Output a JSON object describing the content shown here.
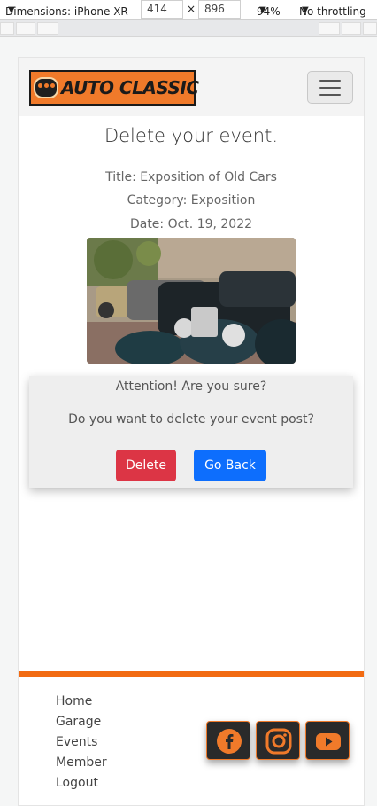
{
  "devtools": {
    "device": "Dimensions: iPhone XR",
    "width": "414",
    "times": "×",
    "height": "896",
    "zoom": "94%",
    "throttle": "No throttling"
  },
  "brand": {
    "name": "AUTO CLASSIC"
  },
  "page": {
    "title": "Delete your event.",
    "event_title": "Title: Exposition of Old Cars",
    "category": "Category: Exposition",
    "date": "Date: Oct. 19, 2022",
    "photo_alt": "Exposition of Old Cars"
  },
  "confirm": {
    "heading": "Attention! Are you sure?",
    "question": "Do you want to delete your event post?",
    "delete_label": "Delete",
    "back_label": "Go Back"
  },
  "footer": {
    "links": [
      "Home",
      "Garage",
      "Events",
      "Member",
      "Logout"
    ],
    "social": [
      {
        "icon": "facebook-icon"
      },
      {
        "icon": "instagram-icon"
      },
      {
        "icon": "youtube-icon"
      }
    ],
    "accent": "#f26b12"
  }
}
